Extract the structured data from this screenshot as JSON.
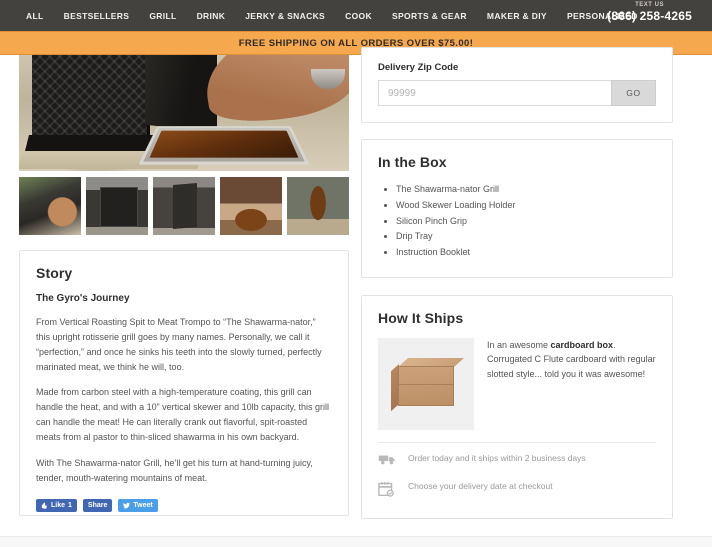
{
  "topnav": {
    "links": [
      {
        "label": "ALL"
      },
      {
        "label": "BESTSELLERS"
      },
      {
        "label": "GRILL"
      },
      {
        "label": "DRINK"
      },
      {
        "label": "JERKY & SNACKS"
      },
      {
        "label": "COOK"
      },
      {
        "label": "SPORTS & GEAR"
      },
      {
        "label": "MAKER & DIY"
      },
      {
        "label": "PERSONALIZED"
      }
    ],
    "text_us_label": "TEXT US",
    "phone": "(866) 258-4265",
    "bg_color": "#44423f"
  },
  "promo_banner": {
    "text": "FREE SHIPPING ON ALL ORDERS OVER $75.00!",
    "bg_color": "#f5a84e"
  },
  "gallery": {
    "main_image_alt": "Shawarma-nator grill with drip tray being loaded",
    "thumbnails": [
      {
        "alt": "Grill with meat on skewer being handled",
        "selected": true
      },
      {
        "alt": "Front view of the upright rotisserie grill",
        "selected": false
      },
      {
        "alt": "Side angle view of the grill",
        "selected": false
      },
      {
        "alt": "Hands carving spit-roasted meat",
        "selected": false
      },
      {
        "alt": "Tall stack of shawarma meat on skewer",
        "selected": false
      }
    ],
    "selected_indicator_color": "#3b8fd4"
  },
  "story": {
    "title": "Story",
    "subtitle": "The Gyro's Journey",
    "paragraphs": [
      "From Vertical Roasting Spit to Meat Trompo to “The Shawarma-nator,” this upright rotisserie grill goes by many names. Personally, we call it “perfection,” and once he sinks his teeth into the slowly turned, perfectly marinated meat, we think he will, too.",
      "Made from carbon steel with a high-temperature coating, this grill can handle the heat, and with a 10” vertical skewer and 10lb capacity, this grill can handle the meat! He can literally crank out flavorful, spit-roasted meats from al pastor to thin-sliced shawarma in his own backyard.",
      "With The Shawarma-nator Grill, he’ll get his turn at hand-turning juicy, tender, mouth-watering mountains of meat."
    ],
    "social": {
      "facebook_like_label": "Like",
      "facebook_like_count": "1",
      "facebook_share_label": "Share",
      "twitter_label": "Tweet"
    }
  },
  "delivery": {
    "label": "Delivery Zip Code",
    "input_value": "",
    "input_placeholder": "99999",
    "go_label": "GO"
  },
  "in_the_box": {
    "title": "In the Box",
    "items": [
      "The Shawarma-nator Grill",
      "Wood Skewer Loading Holder",
      "Silicon Pinch Grip",
      "Drip Tray",
      "Instruction Booklet"
    ]
  },
  "how_it_ships": {
    "title": "How It Ships",
    "image_alt": "Plain corrugated cardboard shipping box",
    "description_lead": "In an awesome ",
    "description_bold": "cardboard box",
    "description_rest": ". Corrugated C Flute cardboard with regular slotted style... told you it was awesome!",
    "features": [
      {
        "icon": "truck-icon",
        "text": "Order today and it ships within 2 business days"
      },
      {
        "icon": "calendar-check-icon",
        "text": "Choose your delivery date at checkout"
      }
    ]
  }
}
